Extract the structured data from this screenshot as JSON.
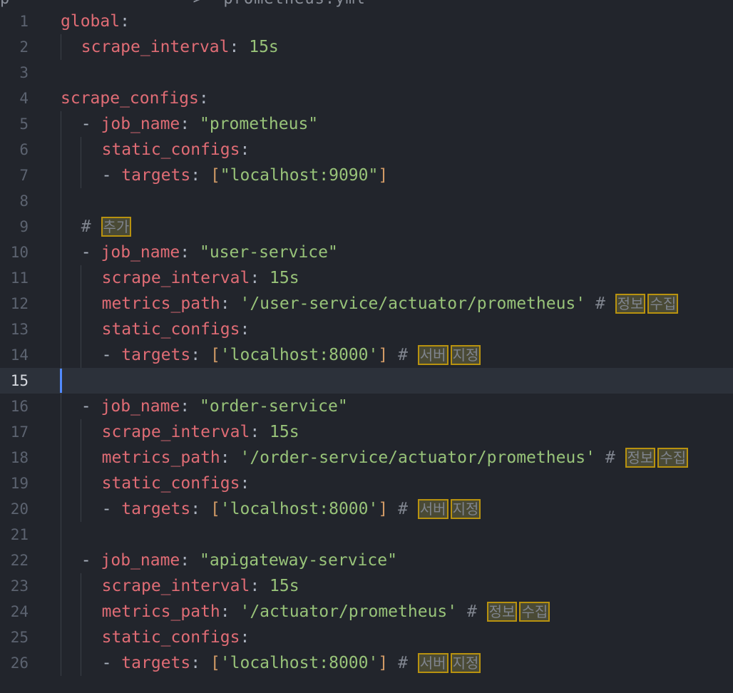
{
  "header": {
    "breadcrumb": "p                  >  prometheus.yml"
  },
  "editor": {
    "active_line": 15,
    "lines": [
      {
        "n": "1",
        "indent": 0,
        "tokens": [
          [
            "k",
            "global"
          ],
          [
            "p",
            ":"
          ]
        ]
      },
      {
        "n": "2",
        "indent": 1,
        "tokens": [
          [
            "k",
            "scrape_interval"
          ],
          [
            "p",
            ": "
          ],
          [
            "n",
            "15s"
          ]
        ]
      },
      {
        "n": "3",
        "indent": 0,
        "tokens": []
      },
      {
        "n": "4",
        "indent": 0,
        "tokens": [
          [
            "k",
            "scrape_configs"
          ],
          [
            "p",
            ":"
          ]
        ]
      },
      {
        "n": "5",
        "indent": 1,
        "tokens": [
          [
            "p",
            "- "
          ],
          [
            "k",
            "job_name"
          ],
          [
            "p",
            ": "
          ],
          [
            "s",
            "\"prometheus\""
          ]
        ]
      },
      {
        "n": "6",
        "indent": 2,
        "tokens": [
          [
            "k",
            "static_configs"
          ],
          [
            "p",
            ":"
          ]
        ]
      },
      {
        "n": "7",
        "indent": 2,
        "tokens": [
          [
            "p",
            "- "
          ],
          [
            "k",
            "targets"
          ],
          [
            "p",
            ": "
          ],
          [
            "br",
            "["
          ],
          [
            "s",
            "\"localhost:9090\""
          ],
          [
            "br",
            "]"
          ]
        ]
      },
      {
        "n": "8",
        "indent": 0,
        "tokens": []
      },
      {
        "n": "9",
        "indent": 1,
        "tokens": [
          [
            "c",
            "# "
          ],
          [
            "kw",
            "추가"
          ]
        ]
      },
      {
        "n": "10",
        "indent": 1,
        "tokens": [
          [
            "p",
            "- "
          ],
          [
            "k",
            "job_name"
          ],
          [
            "p",
            ": "
          ],
          [
            "s",
            "\"user-service\""
          ]
        ]
      },
      {
        "n": "11",
        "indent": 2,
        "tokens": [
          [
            "k",
            "scrape_interval"
          ],
          [
            "p",
            ": "
          ],
          [
            "n",
            "15s"
          ]
        ]
      },
      {
        "n": "12",
        "indent": 2,
        "tokens": [
          [
            "k",
            "metrics_path"
          ],
          [
            "p",
            ": "
          ],
          [
            "s",
            "'/user-service/actuator/prometheus'"
          ],
          [
            "c",
            " # "
          ],
          [
            "kw",
            "정보"
          ],
          [
            "kw",
            "수집"
          ]
        ]
      },
      {
        "n": "13",
        "indent": 2,
        "tokens": [
          [
            "k",
            "static_configs"
          ],
          [
            "p",
            ":"
          ]
        ]
      },
      {
        "n": "14",
        "indent": 2,
        "tokens": [
          [
            "p",
            "- "
          ],
          [
            "k",
            "targets"
          ],
          [
            "p",
            ": "
          ],
          [
            "br",
            "["
          ],
          [
            "s",
            "'localhost:8000'"
          ],
          [
            "br",
            "]"
          ],
          [
            "c",
            " # "
          ],
          [
            "kw",
            "서버"
          ],
          [
            "kw",
            "지정"
          ]
        ]
      },
      {
        "n": "15",
        "indent": 0,
        "tokens": []
      },
      {
        "n": "16",
        "indent": 1,
        "tokens": [
          [
            "p",
            "- "
          ],
          [
            "k",
            "job_name"
          ],
          [
            "p",
            ": "
          ],
          [
            "s",
            "\"order-service\""
          ]
        ]
      },
      {
        "n": "17",
        "indent": 2,
        "tokens": [
          [
            "k",
            "scrape_interval"
          ],
          [
            "p",
            ": "
          ],
          [
            "n",
            "15s"
          ]
        ]
      },
      {
        "n": "18",
        "indent": 2,
        "tokens": [
          [
            "k",
            "metrics_path"
          ],
          [
            "p",
            ": "
          ],
          [
            "s",
            "'/order-service/actuator/prometheus'"
          ],
          [
            "c",
            " # "
          ],
          [
            "kw",
            "정보"
          ],
          [
            "kw",
            "수집"
          ]
        ]
      },
      {
        "n": "19",
        "indent": 2,
        "tokens": [
          [
            "k",
            "static_configs"
          ],
          [
            "p",
            ":"
          ]
        ]
      },
      {
        "n": "20",
        "indent": 2,
        "tokens": [
          [
            "p",
            "- "
          ],
          [
            "k",
            "targets"
          ],
          [
            "p",
            ": "
          ],
          [
            "br",
            "["
          ],
          [
            "s",
            "'localhost:8000'"
          ],
          [
            "br",
            "]"
          ],
          [
            "c",
            " # "
          ],
          [
            "kw",
            "서버"
          ],
          [
            "kw",
            "지정"
          ]
        ]
      },
      {
        "n": "21",
        "indent": 0,
        "tokens": []
      },
      {
        "n": "22",
        "indent": 1,
        "tokens": [
          [
            "p",
            "- "
          ],
          [
            "k",
            "job_name"
          ],
          [
            "p",
            ": "
          ],
          [
            "s",
            "\"apigateway-service\""
          ]
        ]
      },
      {
        "n": "23",
        "indent": 2,
        "tokens": [
          [
            "k",
            "scrape_interval"
          ],
          [
            "p",
            ": "
          ],
          [
            "n",
            "15s"
          ]
        ]
      },
      {
        "n": "24",
        "indent": 2,
        "tokens": [
          [
            "k",
            "metrics_path"
          ],
          [
            "p",
            ": "
          ],
          [
            "s",
            "'/actuator/prometheus'"
          ],
          [
            "c",
            " # "
          ],
          [
            "kw",
            "정보"
          ],
          [
            "kw",
            "수집"
          ]
        ]
      },
      {
        "n": "25",
        "indent": 2,
        "tokens": [
          [
            "k",
            "static_configs"
          ],
          [
            "p",
            ":"
          ]
        ]
      },
      {
        "n": "26",
        "indent": 2,
        "tokens": [
          [
            "p",
            "- "
          ],
          [
            "k",
            "targets"
          ],
          [
            "p",
            ": "
          ],
          [
            "br",
            "["
          ],
          [
            "s",
            "'localhost:8000'"
          ],
          [
            "br",
            "]"
          ],
          [
            "c",
            " # "
          ],
          [
            "kw",
            "서버"
          ],
          [
            "kw",
            "지정"
          ]
        ]
      }
    ]
  },
  "colors": {
    "background": "#22252c",
    "key": "#e06c75",
    "string": "#98c379",
    "bracket": "#d19a66",
    "comment": "#7f848e",
    "cursor": "#528bff"
  }
}
